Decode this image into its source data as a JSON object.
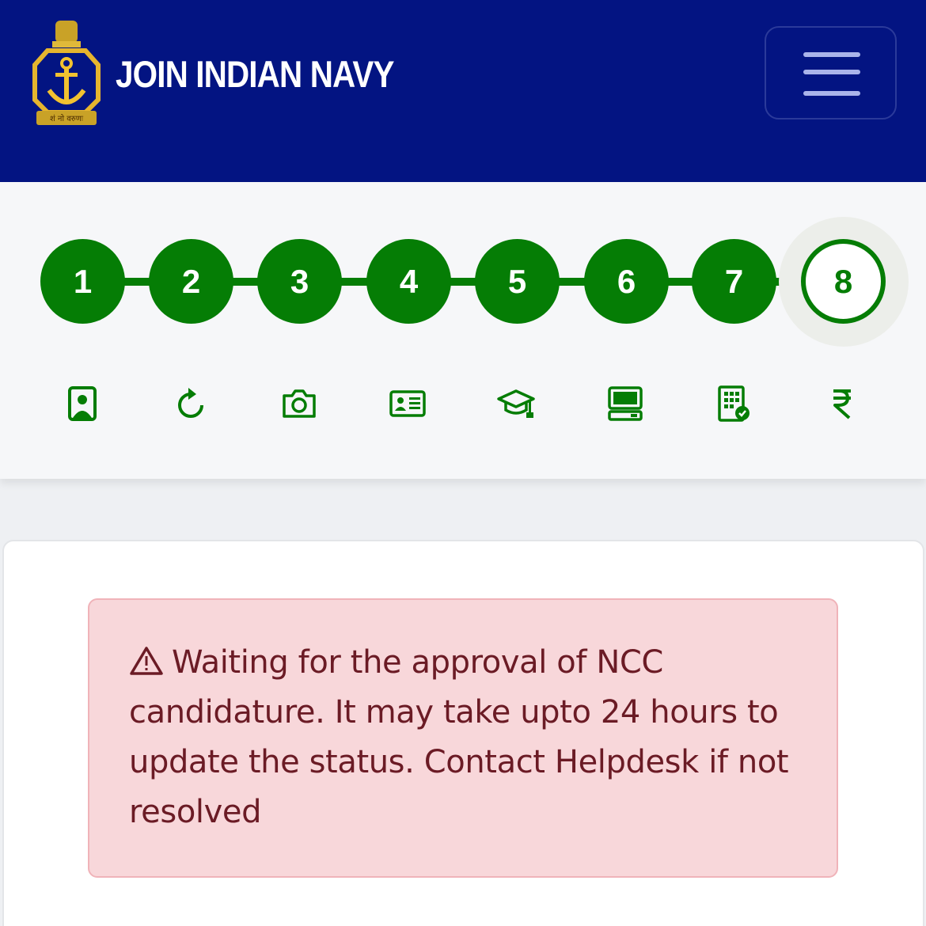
{
  "header": {
    "brand_title": "JOIN INDIAN NAVY",
    "emblem_motto": "शं नो वरुणः",
    "background_color": "#031482",
    "menu_icon": "hamburger-menu-icon"
  },
  "stepper": {
    "accent_color": "#057d05",
    "current_step": 8,
    "steps": [
      {
        "label": "1",
        "icon": "user-portrait-icon"
      },
      {
        "label": "2",
        "icon": "refresh-icon"
      },
      {
        "label": "3",
        "icon": "camera-icon"
      },
      {
        "label": "4",
        "icon": "id-card-icon"
      },
      {
        "label": "5",
        "icon": "graduation-cap-icon"
      },
      {
        "label": "6",
        "icon": "computer-icon"
      },
      {
        "label": "7",
        "icon": "building-check-icon"
      },
      {
        "label": "8",
        "icon": "rupee-icon"
      }
    ]
  },
  "alert": {
    "icon": "warning-icon",
    "message": "Waiting for the approval of NCC candidature. It may take upto 24 hours to update the status. Contact Helpdesk if not resolved",
    "background_color": "#f8d7da",
    "text_color": "#6b1b25"
  }
}
